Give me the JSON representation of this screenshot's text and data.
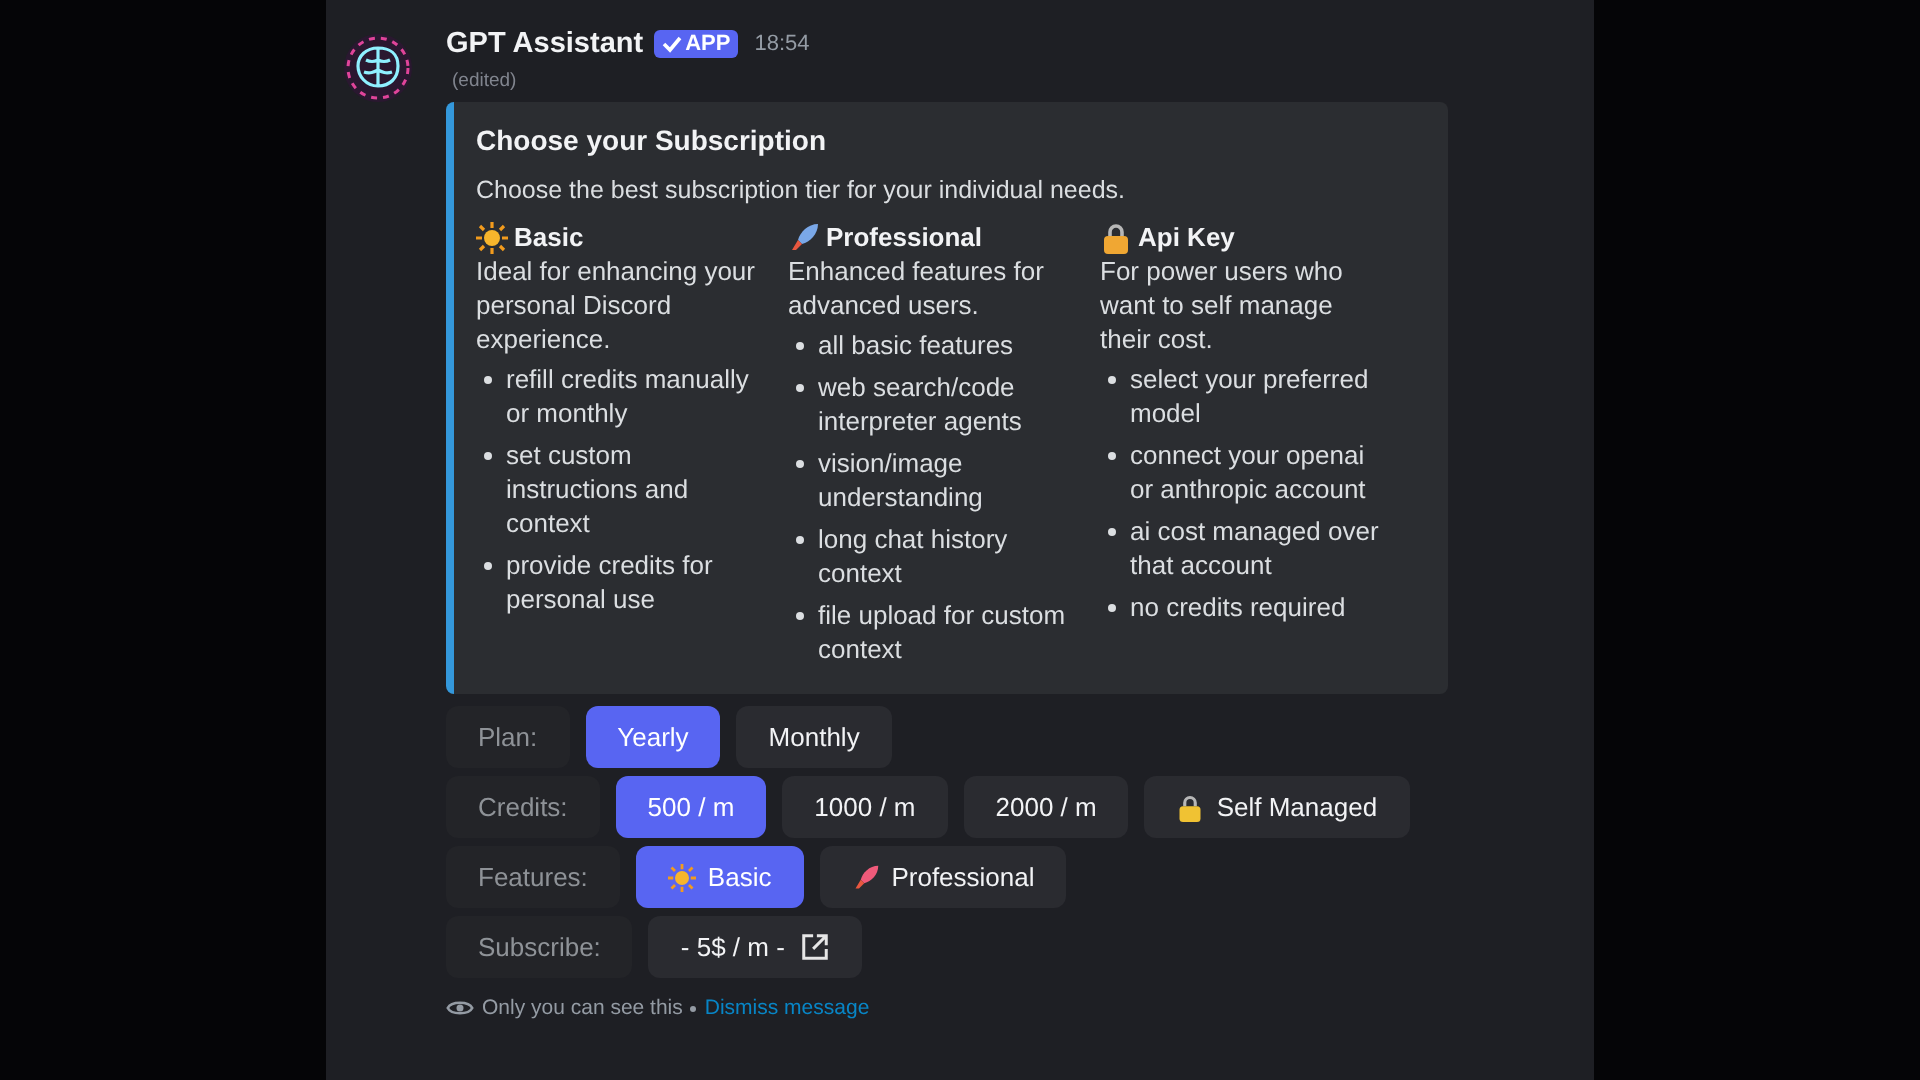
{
  "message": {
    "author": "GPT Assistant",
    "badge": "APP",
    "time": "18:54",
    "edited": "(edited)"
  },
  "embed": {
    "title": "Choose your Subscription",
    "description": "Choose the best subscription tier for your individual needs.",
    "tiers": [
      {
        "kind": "sun",
        "name": "Basic",
        "text": "Ideal for enhancing your personal Discord experience.",
        "items": [
          "refill credits manually or monthly",
          "set custom instructions and context",
          "provide credits for personal use"
        ]
      },
      {
        "kind": "rocket",
        "name": "Professional",
        "text": "Enhanced features for advanced users.",
        "items": [
          "all basic features",
          "web search/code interpreter agents",
          "vision/image understanding",
          "long chat history context",
          "file upload for custom context"
        ]
      },
      {
        "kind": "lock",
        "name": "Api Key",
        "text": "For power users who want to self manage their cost.",
        "items": [
          "select your preferred model",
          "connect your openai or anthropic account",
          "ai cost managed over that account",
          "no credits required"
        ]
      }
    ]
  },
  "rows": [
    {
      "label": "Plan:",
      "options": [
        {
          "label": "Yearly",
          "selected": true
        },
        {
          "label": "Monthly",
          "selected": false
        }
      ]
    },
    {
      "label": "Credits:",
      "options": [
        {
          "label": "500 / m",
          "selected": true
        },
        {
          "label": "1000 / m",
          "selected": false
        },
        {
          "label": "2000 / m",
          "selected": false
        },
        {
          "label": "Self Managed",
          "selected": false,
          "kind": "lock"
        }
      ]
    },
    {
      "label": "Features:",
      "options": [
        {
          "label": "Basic",
          "selected": true,
          "kind": "sun"
        },
        {
          "label": "Professional",
          "selected": false,
          "kind": "rocket"
        }
      ]
    },
    {
      "label": "Subscribe:",
      "options": [
        {
          "label": "- 5$ / m -",
          "selected": false,
          "kind": "link"
        }
      ]
    }
  ],
  "footer": {
    "note": "Only you can see this",
    "link": "Dismiss message"
  }
}
